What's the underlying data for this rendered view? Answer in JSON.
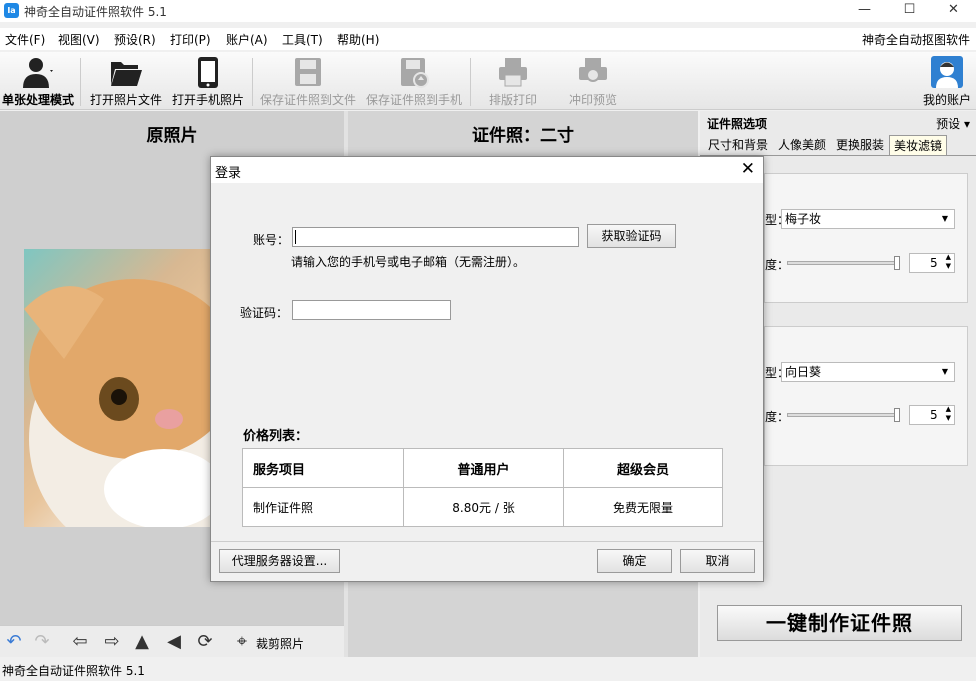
{
  "window": {
    "title": "神奇全自动证件照软件 5.1",
    "app_icon": "Ia"
  },
  "menu": {
    "items": [
      "文件(F)",
      "视图(V)",
      "预设(R)",
      "打印(P)",
      "账户(A)",
      "工具(T)",
      "帮助(H)"
    ],
    "right_link": "神奇全自动抠图软件"
  },
  "toolbar": {
    "single_mode": "单张处理模式",
    "open_file": "打开照片文件",
    "open_phone": "打开手机照片",
    "save_file": "保存证件照到文件",
    "save_phone": "保存证件照到手机",
    "layout_print": "排版打印",
    "print_preview": "冲印预览",
    "my_account": "我的账户"
  },
  "left_panel": {
    "title": "原照片",
    "crop_label": "裁剪照片"
  },
  "mid_panel": {
    "title": "证件照：二寸"
  },
  "right_panel": {
    "title": "证件照选项",
    "preset": "预设",
    "tabs": [
      "尺寸和背景",
      "人像美颜",
      "更换服装",
      "美妆滤镜"
    ],
    "active_tab": 3,
    "group1": {
      "type_label": "型：",
      "type_value": "梅子妆",
      "strength_label": "度：",
      "strength_value": "5"
    },
    "group2": {
      "type_label": "型：",
      "type_value": "向日葵",
      "strength_label": "度：",
      "strength_value": "5"
    },
    "make_button": "一键制作证件照"
  },
  "status": {
    "text": "神奇全自动证件照软件 5.1"
  },
  "dialog": {
    "title": "登录",
    "account_label": "账号：",
    "account_value": "",
    "get_code_button": "获取验证码",
    "hint": "请输入您的手机号或电子邮箱（无需注册）。",
    "code_label": "验证码：",
    "code_value": "",
    "price_title": "价格列表：",
    "price_table": {
      "headers": [
        "服务项目",
        "普通用户",
        "超级会员"
      ],
      "rows": [
        [
          "制作证件照",
          "8.80元 / 张",
          "免费无限量"
        ]
      ]
    },
    "proxy_button": "代理服务器设置...",
    "ok_button": "确定",
    "cancel_button": "取消"
  }
}
